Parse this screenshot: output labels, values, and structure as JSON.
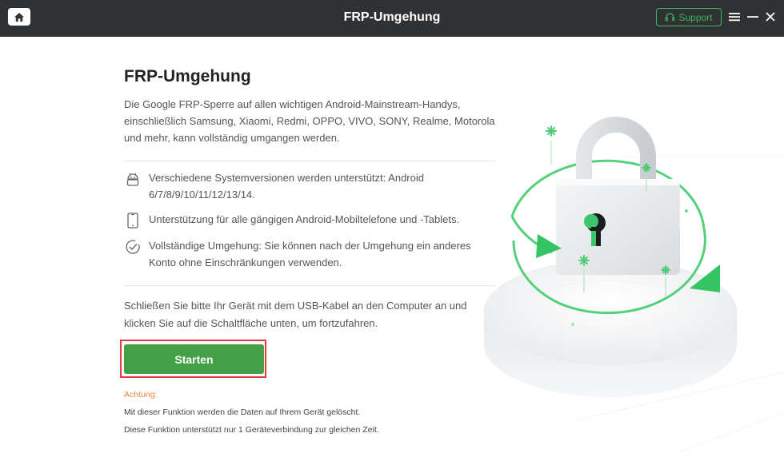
{
  "window": {
    "title": "FRP-Umgehung",
    "support_label": "Support",
    "accent": "#3fb55a",
    "titlebar_bg": "#2f3133"
  },
  "main": {
    "heading": "FRP-Umgehung",
    "intro": "Die Google FRP-Sperre auf allen wichtigen Android-Mainstream-Handys, einschließlich Samsung, Xiaomi, Redmi, OPPO, VIVO, SONY, Realme, Motorola und mehr, kann vollständig umgangen werden.",
    "features": [
      {
        "icon": "android-icon",
        "text": "Verschiedene Systemversionen werden unterstützt: Android 6/7/8/9/10/11/12/13/14."
      },
      {
        "icon": "phone-icon",
        "text": "Unterstützung für alle gängigen Android-Mobiltelefone und -Tablets."
      },
      {
        "icon": "check-circle-icon",
        "text": "Vollständige Umgehung: Sie können nach der Umgehung ein anderes Konto ohne Einschränkungen verwenden."
      }
    ],
    "instruction": "Schließen Sie bitte Ihr Gerät mit dem USB-Kabel an den Computer an und klicken Sie auf die Schaltfläche unten, um fortzufahren.",
    "start_label": "Starten",
    "start_color": "#43a047",
    "highlight_color": "#e0393e",
    "warning": {
      "label": "Achtung:",
      "label_color": "#f0853a",
      "lines": [
        "Mit dieser Funktion werden die Daten auf Ihrem Gerät gelöscht.",
        "Diese Funktion unterstützt nur 1 Geräteverbindung zur gleichen Zeit."
      ]
    }
  }
}
